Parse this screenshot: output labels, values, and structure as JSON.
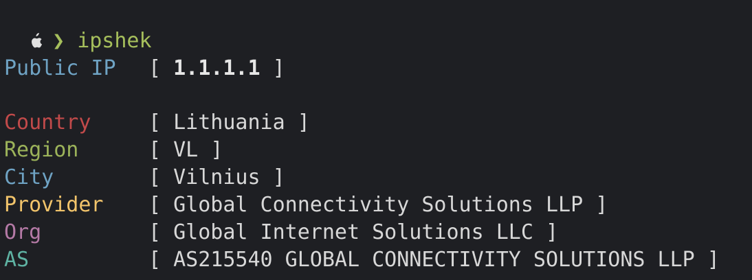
{
  "prompt": {
    "icon": "apple-icon",
    "chevron": "❯",
    "command": "ipshek"
  },
  "public_ip": {
    "label": "Public IP",
    "value": "1.1.1.1",
    "color": "#6fa3c4"
  },
  "fields": {
    "country": {
      "label": "Country",
      "value": "Lithuania",
      "color": "#c14a4a"
    },
    "region": {
      "label": "Region",
      "value": "VL",
      "color": "#9cb35a"
    },
    "city": {
      "label": "City",
      "value": "Vilnius",
      "color": "#6fa3c4"
    },
    "provider": {
      "label": "Provider",
      "value": "Global Connectivity Solutions LLP",
      "color": "#f2c46b"
    },
    "org": {
      "label": "Org",
      "value": "Global Internet Solutions LLC",
      "color": "#b57aa6"
    },
    "as": {
      "label": "AS",
      "value": "AS215540 GLOBAL CONNECTIVITY SOLUTIONS LLP",
      "color": "#5fb3a3"
    }
  },
  "brackets": {
    "open": "[",
    "close": "]"
  },
  "colors": {
    "background": "#1e1f23",
    "text": "#d8d8d8",
    "prompt_green": "#a6bf5c"
  }
}
